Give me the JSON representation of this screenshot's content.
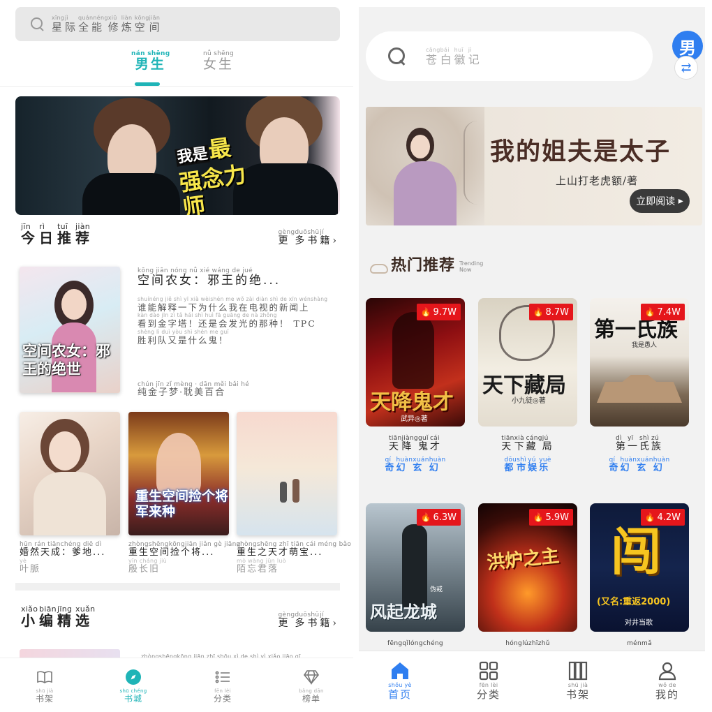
{
  "left": {
    "search": {
      "py": [
        "xīng",
        "jì",
        "quánnéng",
        "xiū",
        "liàn",
        "kōng",
        "jiān"
      ],
      "hz": [
        "星",
        "际",
        "全能",
        "修",
        "炼",
        "空",
        "间"
      ]
    },
    "tabs": {
      "male": {
        "py": "nán shēng",
        "label": "男生"
      },
      "female": {
        "py": "nǚ shēng",
        "label": "女生"
      }
    },
    "today": {
      "title_py": [
        "jīn",
        "rì",
        "tuī",
        "jiàn"
      ],
      "title": [
        "今",
        "日",
        "推",
        "荐"
      ],
      "more_py": [
        "gèng",
        "duō",
        "shū",
        "jí"
      ],
      "more": [
        "更",
        "多",
        "书",
        "籍"
      ]
    },
    "featured": {
      "cover_text": "空间农女：邪王的绝世",
      "title_py": "kōng jiān nóng nǚ     xié wáng de jué",
      "title": "空间农女：邪王的绝...",
      "desc_lines": [
        {
          "py": "shuínéng jiě shì yī xià wèishén me wǒ zài diàn shì de xīn wénshàng",
          "hz": "谁能解释一下为什么我在电视的新闻上"
        },
        {
          "py": "kàn dào jīn zì tǎ hái shì huì fā guāng de nà zhǒng",
          "hz": "看到金字塔！还是会发光的那种！ TPC"
        },
        {
          "py": "shèng lì duì yòu shì shén me guǐ",
          "hz": "胜利队又是什么鬼！"
        }
      ],
      "author_py": "chún jīn zǐ mèng · dān měi bǎi hé",
      "author": "纯金子梦·耽美百合"
    },
    "grid": [
      {
        "title_py": "hūn rán tiānchéng   diē dì",
        "title": "婚然天成：爹地...",
        "author_py": "yè",
        "author": "叶脈"
      },
      {
        "title_py": "zhòngshēngkōngjiān jiǎn gè jiāng",
        "title": "重生空间捡个将...",
        "author_py": "yīn cháng jiù",
        "author": "殷长旧",
        "cover_text": "重生空间捡个将军来种"
      },
      {
        "title_py": "zhòngshēng zhī tiān cái méng bǎo",
        "title": "重生之天才萌宝...",
        "author_py": "mò wàng jūn luò",
        "author": "陌忘君落"
      }
    ],
    "editor": {
      "title_py": [
        "xiǎo",
        "biān",
        "jīng",
        "xuǎn"
      ],
      "title": [
        "小",
        "编",
        "精",
        "选"
      ],
      "more_py": [
        "gèng",
        "duō",
        "shū",
        "jí"
      ],
      "more": [
        "更",
        "多",
        "书",
        "籍"
      ],
      "peek_py": "zhòngshēngkōng jiān zhī shōu xì de shì yì xiǎo jiāo qī"
    },
    "banner": {
      "small": "我是",
      "big": "最强念力师"
    },
    "tabbar": [
      {
        "py": "shū jià",
        "label": "书架",
        "icon": "book-open-icon"
      },
      {
        "py": "shū chéng",
        "label": "书城",
        "icon": "compass-icon"
      },
      {
        "py": "fēn lèi",
        "label": "分类",
        "icon": "list-icon"
      },
      {
        "py": "bǎng dān",
        "label": "榜单",
        "icon": "diamond-icon"
      }
    ]
  },
  "right": {
    "search": {
      "py": [
        "cāng",
        "bái",
        "huī",
        "jì"
      ],
      "hz": [
        "苍",
        "白",
        "徽",
        "记"
      ]
    },
    "gender_badge": "男",
    "banner": {
      "title": "我的姐夫是太子",
      "author": "上山打老虎额/著",
      "cta": "立即阅读"
    },
    "hot": {
      "title": "热门推荐",
      "sub_line1": "Trending",
      "sub_line2": "Now"
    },
    "books": [
      {
        "title_py": [
          "tiān",
          "jiàng",
          "guǐ",
          "cái"
        ],
        "title": [
          "天",
          "降",
          "鬼",
          "才"
        ],
        "genre_py": [
          "qí",
          "huàn",
          "xuán",
          "huàn"
        ],
        "genre": [
          "奇",
          "幻",
          "玄",
          "幻"
        ],
        "heat": "9.7W",
        "cover_text": "天降鬼才",
        "cover_author": "武异◎著"
      },
      {
        "title_py": [
          "tiān",
          "xià",
          "cáng",
          "jú"
        ],
        "title": [
          "天",
          "下",
          "藏",
          "局"
        ],
        "genre_py": [
          "dōu",
          "shì",
          "yú",
          "yuè"
        ],
        "genre": [
          "都",
          "市",
          "娱",
          "乐"
        ],
        "heat": "8.7W",
        "cover_text": "天下藏局",
        "cover_author": "小九徒◎著"
      },
      {
        "title_py": [
          "dì",
          "yī",
          "shì",
          "zú"
        ],
        "title": [
          "第",
          "一",
          "氏",
          "族"
        ],
        "genre_py": [
          "qí",
          "huàn",
          "xuán",
          "huàn"
        ],
        "genre": [
          "奇",
          "幻",
          "玄",
          "幻"
        ],
        "heat": "7.4W",
        "cover_text": "第一氏族",
        "cover_author": "我是愚人"
      },
      {
        "title_py": [
          "fēng",
          "qǐ",
          "lóng",
          "chéng"
        ],
        "title": [
          "",
          "",
          "",
          ""
        ],
        "heat": "6.3W",
        "cover_text": "风起龙城",
        "cover_author": "伪戒"
      },
      {
        "title_py": [
          "hóng",
          "lú",
          "zhī",
          "zhǔ"
        ],
        "title": [
          "",
          "",
          "",
          ""
        ],
        "heat": "5.9W",
        "cover_text": "洪炉之主"
      },
      {
        "title_py": [
          "mén",
          "mǎ"
        ],
        "title": [
          "",
          ""
        ],
        "heat": "4.2W",
        "cover_text": "闯",
        "cover_sub": "(又名:重返2000)",
        "cover_author": "对井当歌"
      }
    ],
    "tabbar": [
      {
        "py": "shǒu yè",
        "label": "首页",
        "icon": "home-icon"
      },
      {
        "py": "fēn lèi",
        "label": "分类",
        "icon": "grid-icon"
      },
      {
        "py": "shū jià",
        "label": "书架",
        "icon": "bookshelf-icon"
      },
      {
        "py": "wǒ de",
        "label": "我的",
        "icon": "user-icon"
      }
    ]
  },
  "colors": {
    "left_accent": "#1fb4b7",
    "right_accent": "#2f7ef0",
    "heat_badge": "#e5161b"
  }
}
